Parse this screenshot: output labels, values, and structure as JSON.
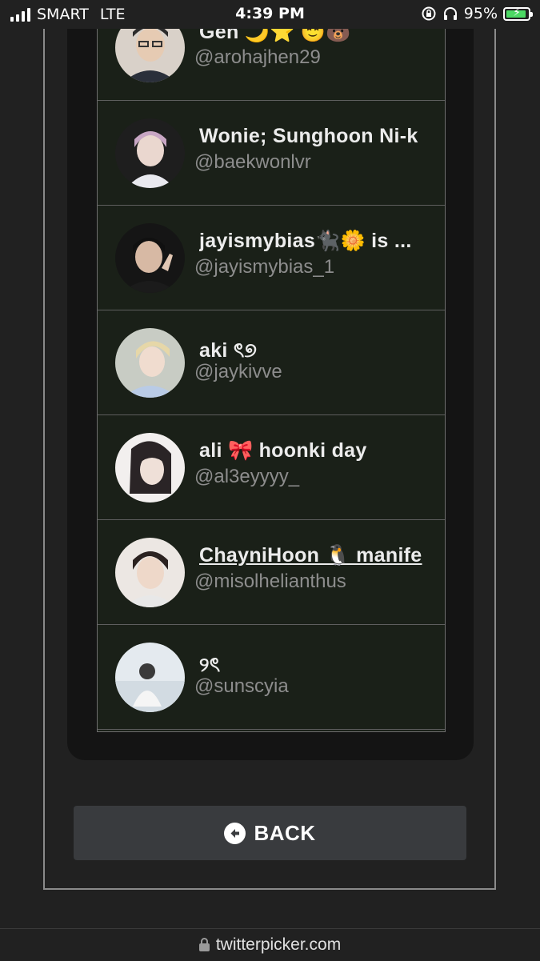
{
  "status_bar": {
    "carrier": "SMART",
    "network": "LTE",
    "time": "4:39 PM",
    "battery_percent": "95%",
    "battery_level": 0.95,
    "battery_color": "#4cd964"
  },
  "users": [
    {
      "name": "Gen 🌙⭐ 😇🐻",
      "handle": "@arohajhen29",
      "avatar_color": "#d8d0c8"
    },
    {
      "name": "Wonie; Sunghoon Ni-k",
      "handle": "@baekwonlvr",
      "avatar_color": "#c9b6c6"
    },
    {
      "name": "jayismybias🐈‍⬛🌼 is ...",
      "handle": "@jayismybias_1",
      "avatar_color": "#2a2a2a"
    },
    {
      "name": "aki ৎ୭",
      "handle": "@jaykivve",
      "avatar_color": "#cfd6e4"
    },
    {
      "name": "ali 🎀 hoonki day",
      "handle": "@al3eyyyy_",
      "avatar_color": "#e9e4e2"
    },
    {
      "name": "ChayniHoon 🐧 manife",
      "handle": "@misolhelianthus",
      "avatar_color": "#e8e3df"
    },
    {
      "name": "୨ৎ",
      "handle": "@sunscyia",
      "avatar_color": "#dfe6ec"
    }
  ],
  "back_button": {
    "label": "BACK",
    "icon": "arrow-left-circle-icon"
  },
  "url_bar": {
    "domain": "twitterpicker.com",
    "icon": "lock-icon"
  }
}
